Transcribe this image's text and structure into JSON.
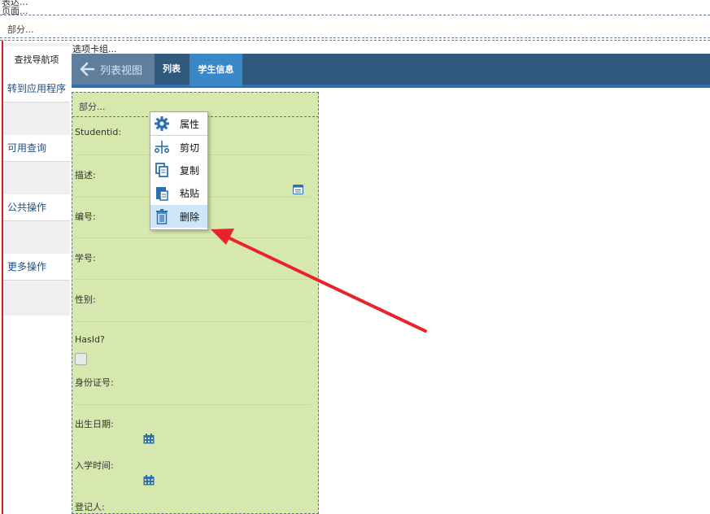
{
  "top": {
    "label1": "表达...",
    "label2": "页面...",
    "section_label": "部分..."
  },
  "left_nav": {
    "find_tab": "查找导航项",
    "items": [
      {
        "label": "转到应用程序"
      },
      {
        "label": "可用查询"
      },
      {
        "label": "公共操作"
      },
      {
        "label": "更多操作"
      }
    ]
  },
  "tab_group_label": "选项卡组...",
  "header": {
    "back_label": "列表视图",
    "tabs": [
      {
        "label": "列表"
      },
      {
        "label": "学生信息"
      }
    ]
  },
  "form": {
    "section_label": "部分...",
    "fields": [
      {
        "label": "Studentid:"
      },
      {
        "label": "描述:"
      },
      {
        "label": "编号:"
      },
      {
        "label": "学号:"
      },
      {
        "label": "性别:"
      },
      {
        "label": "HasId?"
      },
      {
        "label": "身份证号:"
      },
      {
        "label": "出生日期:"
      },
      {
        "label": "入学时间:"
      },
      {
        "label": "登记人:"
      }
    ]
  },
  "context_menu": {
    "items": [
      {
        "label": "属性",
        "icon": "gear-icon"
      },
      {
        "label": "剪切",
        "icon": "scissors-icon"
      },
      {
        "label": "复制",
        "icon": "copy-icon"
      },
      {
        "label": "粘贴",
        "icon": "paste-icon"
      },
      {
        "label": "删除",
        "icon": "trash-icon"
      }
    ]
  },
  "colors": {
    "header_bg": "#31597d",
    "active_tab": "#3a87c8",
    "form_bg": "#d6e8ad",
    "annotation_arrow": "#e8232a",
    "menu_hover": "#cfe6f8"
  }
}
